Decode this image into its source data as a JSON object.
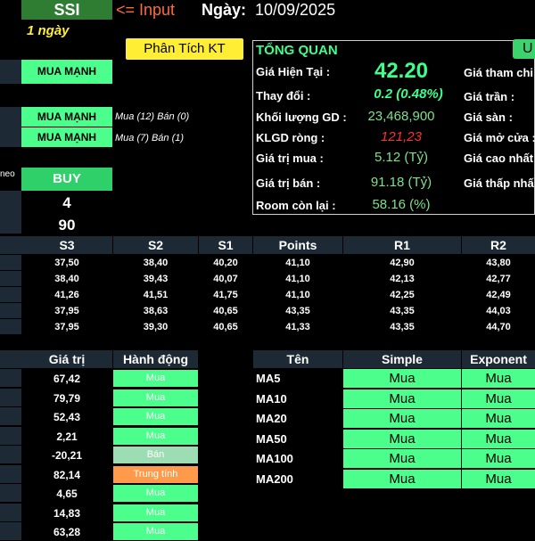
{
  "header": {
    "ticker": "SSI",
    "input_note": "<= Input",
    "date_label": "Ngày:",
    "date_value": "10/09/2025",
    "period": "1 ngày",
    "analysis_button": "Phân Tích KT"
  },
  "signals": {
    "strong1": "MUA MẠNH",
    "strong2": "MUA MẠNH",
    "strong2_note": "Mua (12)  Bán (0)",
    "strong3": "MUA MẠNH",
    "strong3_note": "Mua (7)  Bán (1)",
    "left_edge_fragment": "neo",
    "buy": "BUY",
    "num1": "4",
    "num2": "90"
  },
  "overview": {
    "title": "TỔNG QUAN",
    "right_button_fragment": "U",
    "rows": [
      {
        "label": "Giá Hiện Tại :",
        "value": "42.20"
      },
      {
        "label": "Thay đổi :",
        "value": "0.2 (0.48%)"
      },
      {
        "label": "Khối lượng GD :",
        "value": "23,468,900"
      },
      {
        "label": "KLGD ròng :",
        "value": "121,23"
      },
      {
        "label": "Giá trị mua :",
        "value": "5.12 (Tỷ)"
      },
      {
        "label": "Giá trị bán :",
        "value": "91.18 (Tỷ)"
      },
      {
        "label": "Room còn lại :",
        "value": "58.16 (%)"
      }
    ],
    "right_labels": [
      "Giá tham chi",
      "Giá trần :",
      "Giá sàn :",
      "Giá mở cửa :",
      "Giá cao nhất",
      "Giá thấp nhấ"
    ],
    "colors": {
      "price": "#3cff8c",
      "change": "#3cff8c",
      "volume": "#7fe08a",
      "net": "#ff3030",
      "values": "#7fe08a"
    }
  },
  "pivot": {
    "headers": [
      "S3",
      "S2",
      "S1",
      "Points",
      "R1",
      "R2"
    ],
    "rows": [
      [
        "37,50",
        "38,40",
        "40,20",
        "41,10",
        "42,90",
        "43,80"
      ],
      [
        "38,40",
        "39,43",
        "40,07",
        "41,10",
        "42,13",
        "42,77"
      ],
      [
        "41,26",
        "41,51",
        "41,75",
        "41,10",
        "42,25",
        "42,49"
      ],
      [
        "37,95",
        "38,63",
        "40,65",
        "43,35",
        "43,35",
        "44,03"
      ],
      [
        "37,95",
        "39,30",
        "40,65",
        "41,33",
        "43,35",
        "44,70"
      ]
    ]
  },
  "indicators": {
    "headers": [
      "Giá trị",
      "Hành động"
    ],
    "rows": [
      {
        "value": "67,42",
        "action": "Mua",
        "kind": "buy"
      },
      {
        "value": "79,79",
        "action": "Mua",
        "kind": "buy"
      },
      {
        "value": "52,43",
        "action": "Mua",
        "kind": "buy"
      },
      {
        "value": "2,21",
        "action": "Mua",
        "kind": "buy"
      },
      {
        "value": "-20,21",
        "action": "Bán",
        "kind": "sell"
      },
      {
        "value": "82,14",
        "action": "Trung tính",
        "kind": "neutral"
      },
      {
        "value": "4,65",
        "action": "Mua",
        "kind": "buy"
      },
      {
        "value": "14,83",
        "action": "Mua",
        "kind": "buy"
      },
      {
        "value": "63,28",
        "action": "Mua",
        "kind": "buy"
      }
    ],
    "action_colors": {
      "buy": "#4cff8c",
      "sell": "#9edcb4",
      "neutral": "#ff9a4a"
    }
  },
  "moving_averages": {
    "headers": [
      "Tên",
      "Simple",
      "Exponent"
    ],
    "rows": [
      {
        "name": "MA5",
        "simple": "Mua",
        "exponential": "Mua"
      },
      {
        "name": "MA10",
        "simple": "Mua",
        "exponential": "Mua"
      },
      {
        "name": "MA20",
        "simple": "Mua",
        "exponential": "Mua"
      },
      {
        "name": "MA50",
        "simple": "Mua",
        "exponential": "Mua"
      },
      {
        "name": "MA100",
        "simple": "Mua",
        "exponential": "Mua"
      },
      {
        "name": "MA200",
        "simple": "Mua",
        "exponential": "Mua"
      }
    ]
  }
}
